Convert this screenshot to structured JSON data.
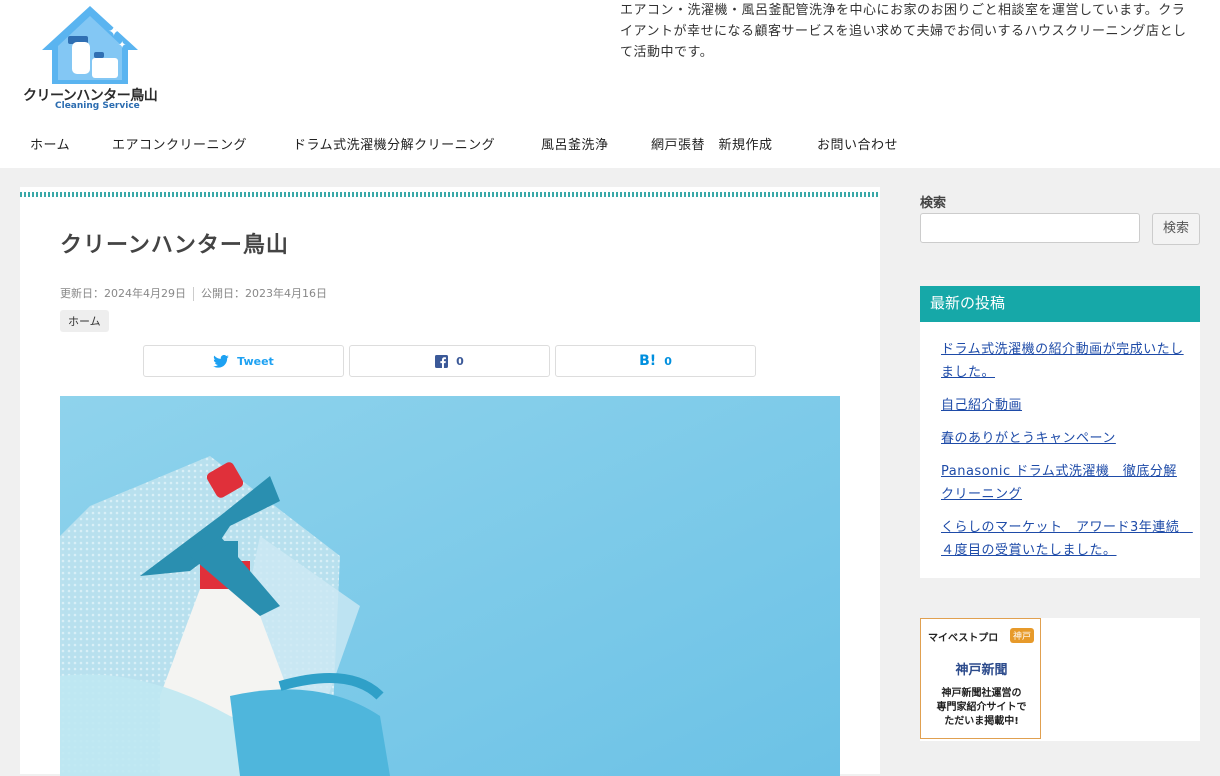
{
  "site": {
    "logo_text": "クリーンハンター鳥山",
    "logo_sub": "Cleaning Service",
    "tagline": "エアコン・洗濯機・風呂釜配管洗浄を中心にお家のお困りごと相談室を運営しています。クライアントが幸せになる顧客サービスを追い求めて夫婦でお伺いするハウスクリーニング店として活動中です。"
  },
  "nav": [
    "ホーム",
    "エアコンクリーニング",
    "ドラム式洗濯機分解クリーニング",
    "風呂釜洗浄",
    "網戸張替　新規作成",
    "お問い合わせ"
  ],
  "article": {
    "title": "クリーンハンター鳥山",
    "updated": "更新日：2024年4月29日",
    "published": "公開日：2023年4月16日",
    "breadcrumb": "ホーム",
    "share": {
      "tweet": "Tweet",
      "fb_count": "0",
      "hb_count": "0"
    }
  },
  "sidebar": {
    "search_label": "検索",
    "search_button": "検索",
    "recent_title": "最新の投稿",
    "recent_posts": [
      "ドラム式洗濯機の紹介動画が完成いたしました。",
      "自己紹介動画",
      "春のありがとうキャンペーン",
      "Panasonic ドラム式洗濯機　徹底分解クリーニング",
      "くらしのマーケット　アワード3年連続　４度目の受賞いたしました。"
    ],
    "banner": {
      "brand": "マイベストプロ",
      "area": "神戸",
      "paper": "神戸新聞",
      "lines": [
        "神戸新聞社運営の",
        "専門家紹介サイトで",
        "ただいま掲載中!"
      ]
    }
  },
  "colors": {
    "accent": "#16a8a8",
    "link": "#1e4ba8"
  }
}
